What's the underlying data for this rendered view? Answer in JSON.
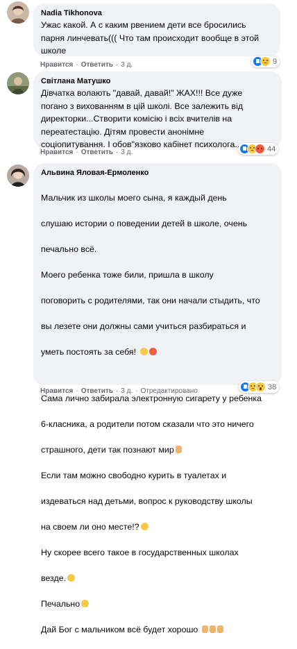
{
  "comments": [
    {
      "author": "Nadia Tikhonova",
      "text": "Ужас какой. А с каким рвением дети все бросились\nпарня линчевать((( Что там происходит вообще в этой\nшколе",
      "like_label": "Нравится",
      "reply_label": "Ответить",
      "time": "3 д.",
      "reactions": [
        "like",
        "sad"
      ],
      "reaction_count": "9"
    },
    {
      "author": "Світлана Матушко",
      "text": "Дівчатка волають \"давай, давай!\" ЖАХ!!! Все дуже\nпогано з вихованням в цій школі. Все залежить від\nдиректорки...Створити комісію і всіх вчителів на\nпереатестацію. Дітям провести анонімне\nсоціопитування. І обов\"язково кабінет психолога...",
      "like_label": "Нравится",
      "reply_label": "Ответить",
      "time": "3 д.",
      "reactions": [
        "like",
        "sad",
        "angry"
      ],
      "reaction_count": "44"
    },
    {
      "author": "Альвина Яловая-Ермоленко",
      "text_lines": [
        "Мальчик из школы моего сына, я каждый день",
        "слушаю истории о поведении детей в школе, очень",
        "печально всё.",
        "Моего ребенка тоже били, пришла в школу",
        "поговорить с родителями, так они начали стыдить, что",
        "вы лезете они должны сами учиться разбираться и",
        "уметь постоять за себя! "
      ],
      "text_lines_2": [
        "Сама лично забирала электронную сигарету у ребенка",
        "6-класника, а родители потом сказали что это ничего",
        "страшного, дети так познают мир",
        "Если там можно свободно курить в туалетах и",
        "издеваться над детьми, вопрос к руководству школы",
        "на своем ли оно месте!?",
        "Ну скорее всего такое в государственных школах",
        "везде.",
        "Печально",
        "Дай Бог с мальчиком всё будет хорошо "
      ],
      "like_label": "Нравится",
      "reply_label": "Ответить",
      "time": "3 д.",
      "edited_label": "Отредактировано",
      "reactions": [
        "like",
        "sad",
        "wow"
      ],
      "reaction_count": "38"
    }
  ]
}
